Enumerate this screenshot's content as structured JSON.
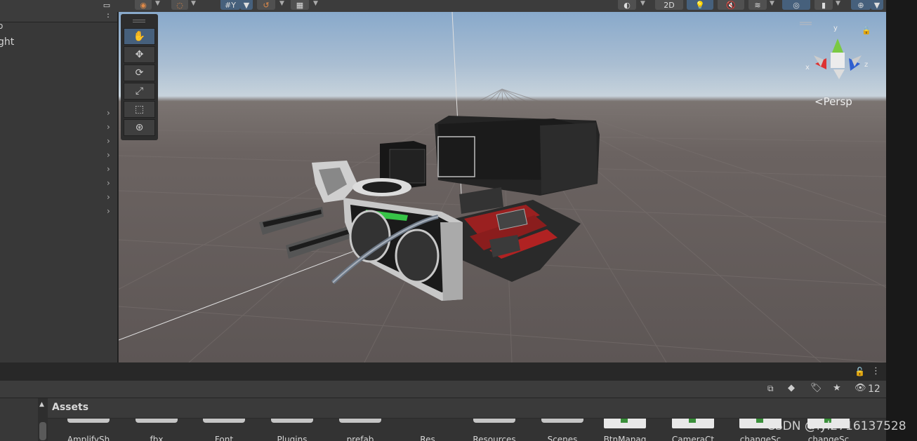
{
  "hierarchy": {
    "partial_items": [
      "o",
      "ght"
    ],
    "collapsed_rows": 8
  },
  "toolbar": {
    "mode_2d": "2D"
  },
  "tools": [
    "hand",
    "move",
    "rotate",
    "scale",
    "rect",
    "transform"
  ],
  "scene": {
    "view_label": "<Persp",
    "axes": {
      "x": "x",
      "y": "y",
      "z": "z"
    }
  },
  "project": {
    "hidden_count": "12",
    "search_placeholder": "",
    "folder_title": "Assets",
    "assets": [
      {
        "name": "AmplifySh",
        "kind": "folder"
      },
      {
        "name": "fbx",
        "kind": "folder"
      },
      {
        "name": "Font",
        "kind": "folder"
      },
      {
        "name": "Plugins",
        "kind": "folder"
      },
      {
        "name": "prefab",
        "kind": "folder"
      },
      {
        "name": "Res",
        "kind": "folder"
      },
      {
        "name": "Resources",
        "kind": "folder"
      },
      {
        "name": "Scenes",
        "kind": "folder"
      },
      {
        "name": "BtnManag",
        "kind": "script"
      },
      {
        "name": "CameraCt",
        "kind": "script"
      },
      {
        "name": "changeSc",
        "kind": "script"
      },
      {
        "name": "changeSc",
        "kind": "script"
      }
    ]
  },
  "watermark": "CSDN @lyl2716137528"
}
